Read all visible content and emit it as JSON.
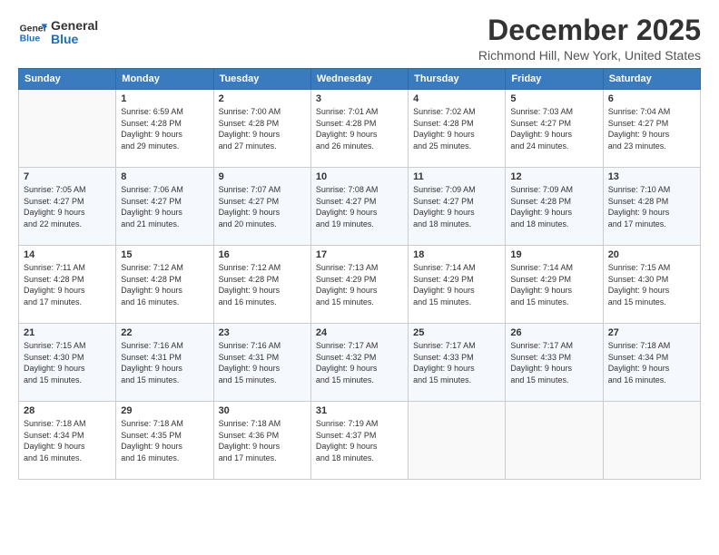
{
  "logo": {
    "line1": "General",
    "line2": "Blue"
  },
  "header": {
    "month": "December 2025",
    "location": "Richmond Hill, New York, United States"
  },
  "weekdays": [
    "Sunday",
    "Monday",
    "Tuesday",
    "Wednesday",
    "Thursday",
    "Friday",
    "Saturday"
  ],
  "weeks": [
    [
      {
        "day": "",
        "info": ""
      },
      {
        "day": "1",
        "info": "Sunrise: 6:59 AM\nSunset: 4:28 PM\nDaylight: 9 hours\nand 29 minutes."
      },
      {
        "day": "2",
        "info": "Sunrise: 7:00 AM\nSunset: 4:28 PM\nDaylight: 9 hours\nand 27 minutes."
      },
      {
        "day": "3",
        "info": "Sunrise: 7:01 AM\nSunset: 4:28 PM\nDaylight: 9 hours\nand 26 minutes."
      },
      {
        "day": "4",
        "info": "Sunrise: 7:02 AM\nSunset: 4:28 PM\nDaylight: 9 hours\nand 25 minutes."
      },
      {
        "day": "5",
        "info": "Sunrise: 7:03 AM\nSunset: 4:27 PM\nDaylight: 9 hours\nand 24 minutes."
      },
      {
        "day": "6",
        "info": "Sunrise: 7:04 AM\nSunset: 4:27 PM\nDaylight: 9 hours\nand 23 minutes."
      }
    ],
    [
      {
        "day": "7",
        "info": "Sunrise: 7:05 AM\nSunset: 4:27 PM\nDaylight: 9 hours\nand 22 minutes."
      },
      {
        "day": "8",
        "info": "Sunrise: 7:06 AM\nSunset: 4:27 PM\nDaylight: 9 hours\nand 21 minutes."
      },
      {
        "day": "9",
        "info": "Sunrise: 7:07 AM\nSunset: 4:27 PM\nDaylight: 9 hours\nand 20 minutes."
      },
      {
        "day": "10",
        "info": "Sunrise: 7:08 AM\nSunset: 4:27 PM\nDaylight: 9 hours\nand 19 minutes."
      },
      {
        "day": "11",
        "info": "Sunrise: 7:09 AM\nSunset: 4:27 PM\nDaylight: 9 hours\nand 18 minutes."
      },
      {
        "day": "12",
        "info": "Sunrise: 7:09 AM\nSunset: 4:28 PM\nDaylight: 9 hours\nand 18 minutes."
      },
      {
        "day": "13",
        "info": "Sunrise: 7:10 AM\nSunset: 4:28 PM\nDaylight: 9 hours\nand 17 minutes."
      }
    ],
    [
      {
        "day": "14",
        "info": "Sunrise: 7:11 AM\nSunset: 4:28 PM\nDaylight: 9 hours\nand 17 minutes."
      },
      {
        "day": "15",
        "info": "Sunrise: 7:12 AM\nSunset: 4:28 PM\nDaylight: 9 hours\nand 16 minutes."
      },
      {
        "day": "16",
        "info": "Sunrise: 7:12 AM\nSunset: 4:28 PM\nDaylight: 9 hours\nand 16 minutes."
      },
      {
        "day": "17",
        "info": "Sunrise: 7:13 AM\nSunset: 4:29 PM\nDaylight: 9 hours\nand 15 minutes."
      },
      {
        "day": "18",
        "info": "Sunrise: 7:14 AM\nSunset: 4:29 PM\nDaylight: 9 hours\nand 15 minutes."
      },
      {
        "day": "19",
        "info": "Sunrise: 7:14 AM\nSunset: 4:29 PM\nDaylight: 9 hours\nand 15 minutes."
      },
      {
        "day": "20",
        "info": "Sunrise: 7:15 AM\nSunset: 4:30 PM\nDaylight: 9 hours\nand 15 minutes."
      }
    ],
    [
      {
        "day": "21",
        "info": "Sunrise: 7:15 AM\nSunset: 4:30 PM\nDaylight: 9 hours\nand 15 minutes."
      },
      {
        "day": "22",
        "info": "Sunrise: 7:16 AM\nSunset: 4:31 PM\nDaylight: 9 hours\nand 15 minutes."
      },
      {
        "day": "23",
        "info": "Sunrise: 7:16 AM\nSunset: 4:31 PM\nDaylight: 9 hours\nand 15 minutes."
      },
      {
        "day": "24",
        "info": "Sunrise: 7:17 AM\nSunset: 4:32 PM\nDaylight: 9 hours\nand 15 minutes."
      },
      {
        "day": "25",
        "info": "Sunrise: 7:17 AM\nSunset: 4:33 PM\nDaylight: 9 hours\nand 15 minutes."
      },
      {
        "day": "26",
        "info": "Sunrise: 7:17 AM\nSunset: 4:33 PM\nDaylight: 9 hours\nand 15 minutes."
      },
      {
        "day": "27",
        "info": "Sunrise: 7:18 AM\nSunset: 4:34 PM\nDaylight: 9 hours\nand 16 minutes."
      }
    ],
    [
      {
        "day": "28",
        "info": "Sunrise: 7:18 AM\nSunset: 4:34 PM\nDaylight: 9 hours\nand 16 minutes."
      },
      {
        "day": "29",
        "info": "Sunrise: 7:18 AM\nSunset: 4:35 PM\nDaylight: 9 hours\nand 16 minutes."
      },
      {
        "day": "30",
        "info": "Sunrise: 7:18 AM\nSunset: 4:36 PM\nDaylight: 9 hours\nand 17 minutes."
      },
      {
        "day": "31",
        "info": "Sunrise: 7:19 AM\nSunset: 4:37 PM\nDaylight: 9 hours\nand 18 minutes."
      },
      {
        "day": "",
        "info": ""
      },
      {
        "day": "",
        "info": ""
      },
      {
        "day": "",
        "info": ""
      }
    ]
  ]
}
